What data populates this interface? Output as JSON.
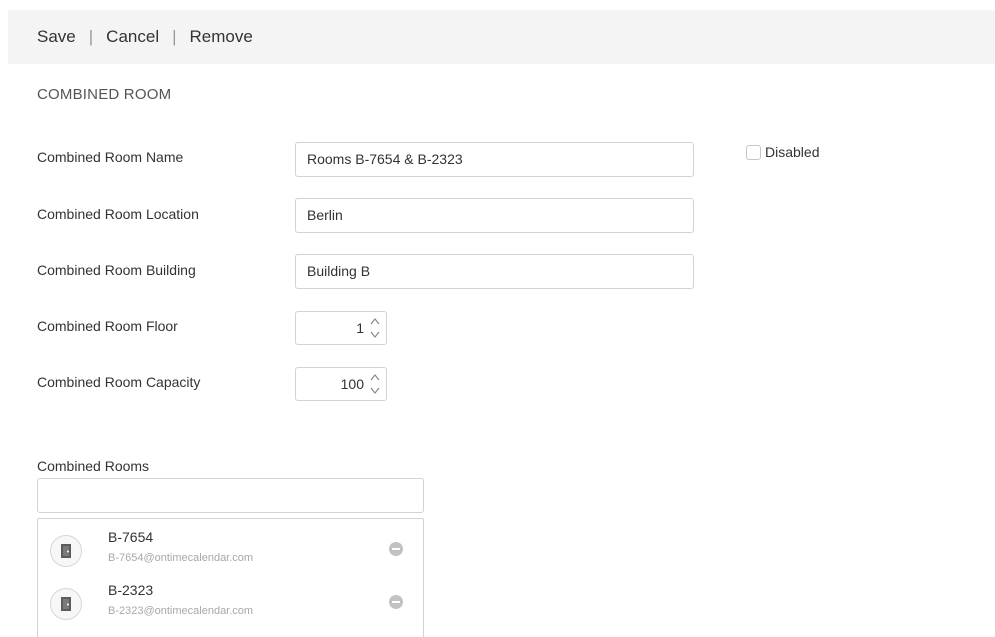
{
  "toolbar": {
    "save_label": "Save",
    "cancel_label": "Cancel",
    "remove_label": "Remove",
    "separator": "|"
  },
  "section_title": "COMBINED ROOM",
  "fields": {
    "name": {
      "label": "Combined Room Name",
      "value": "Rooms B-7654 & B-2323"
    },
    "location": {
      "label": "Combined Room Location",
      "value": "Berlin"
    },
    "building": {
      "label": "Combined Room Building",
      "value": "Building B"
    },
    "floor": {
      "label": "Combined Room Floor",
      "value": "1"
    },
    "capacity": {
      "label": "Combined Room Capacity",
      "value": "100"
    }
  },
  "disabled": {
    "label": "Disabled",
    "checked": false
  },
  "combined_rooms": {
    "label": "Combined Rooms",
    "search_value": "",
    "items": [
      {
        "name": "B-7654",
        "email": "B-7654@ontimecalendar.com",
        "icon": "door-icon"
      },
      {
        "name": "B-2323",
        "email": "B-2323@ontimecalendar.com",
        "icon": "door-icon"
      }
    ]
  }
}
